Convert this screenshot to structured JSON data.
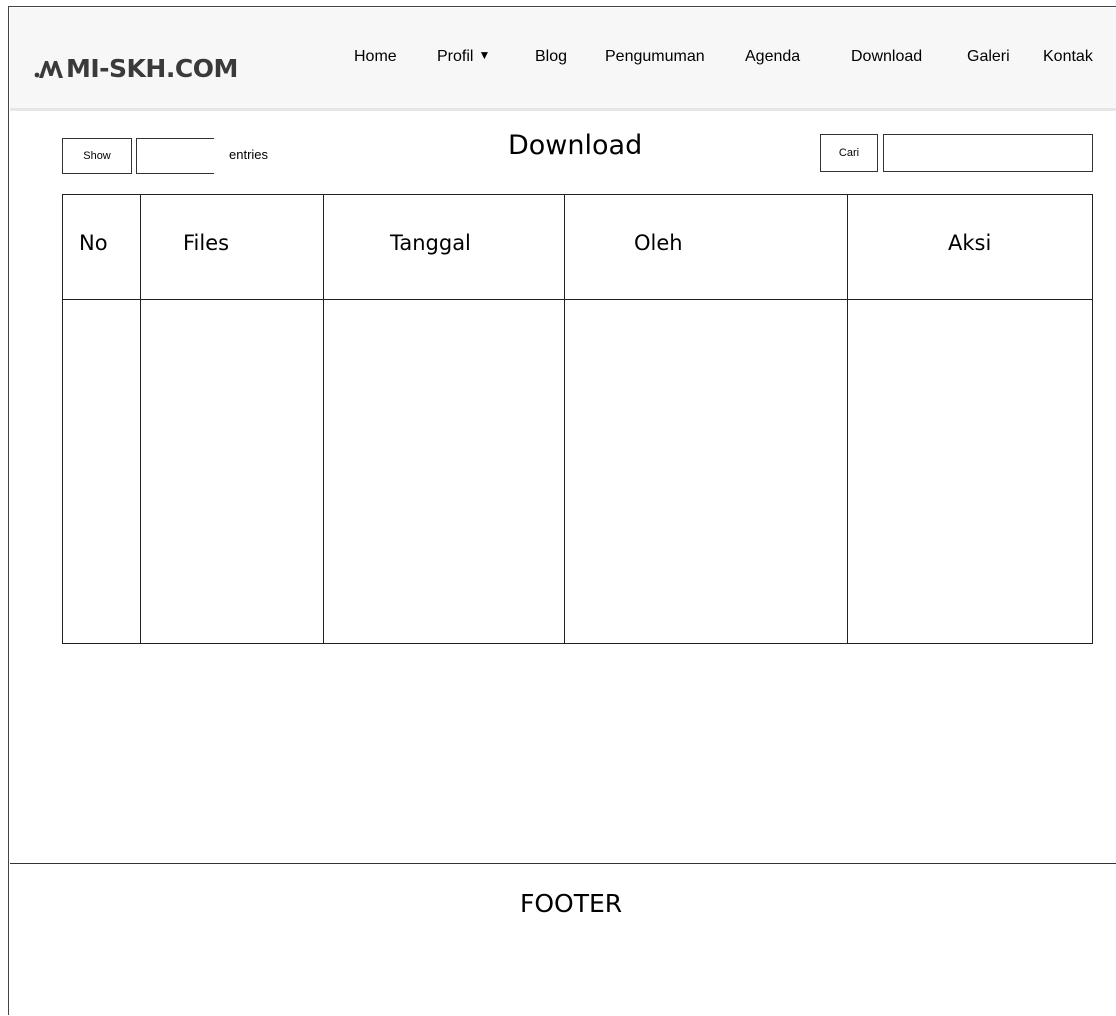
{
  "navbar": {
    "brand": "MI-SKH.COM",
    "brand_icon": "mi-logo-icon",
    "items": [
      {
        "label": "Home"
      },
      {
        "label": "Profil",
        "has_dropdown": true
      },
      {
        "label": "Blog"
      },
      {
        "label": "Pengumuman"
      },
      {
        "label": "Agenda"
      },
      {
        "label": "Download"
      },
      {
        "label": "Galeri"
      },
      {
        "label": "Kontak"
      }
    ]
  },
  "controls": {
    "show_label": "Show",
    "entries_value": "",
    "entries_label": "entries",
    "search_label": "Cari",
    "search_value": ""
  },
  "page": {
    "title": "Download"
  },
  "table": {
    "columns": [
      "No",
      "Files",
      "Tanggal",
      "Oleh",
      "Aksi"
    ],
    "rows": []
  },
  "footer": {
    "text": "FOOTER"
  }
}
